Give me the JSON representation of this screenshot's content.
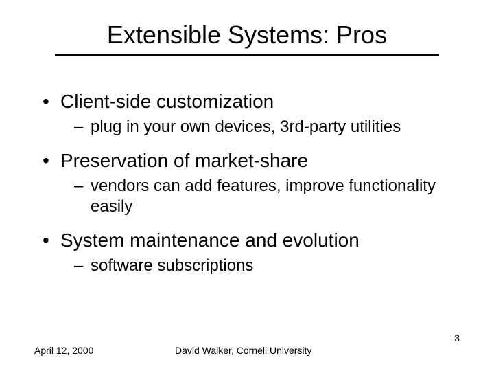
{
  "title": "Extensible Systems: Pros",
  "bullets": [
    {
      "level": 1,
      "text": "Client-side customization"
    },
    {
      "level": 2,
      "text": "plug in your own devices, 3rd-party utilities"
    },
    {
      "level": 1,
      "text": "Preservation of market-share"
    },
    {
      "level": 2,
      "text": "vendors can add features, improve functionality easily"
    },
    {
      "level": 1,
      "text": "System maintenance and evolution"
    },
    {
      "level": 2,
      "text": "software subscriptions"
    }
  ],
  "footer": {
    "date": "April 12, 2000",
    "author": "David Walker, Cornell University",
    "page": "3"
  }
}
